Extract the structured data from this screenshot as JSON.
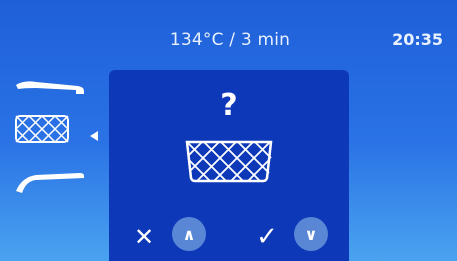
{
  "header": {
    "program": "134°C / 3 min",
    "time": "20:35"
  },
  "sidebar": {
    "items": [
      {
        "icon": "straight-handpiece-icon",
        "selected": false
      },
      {
        "icon": "basket-icon",
        "selected": true
      },
      {
        "icon": "contra-angle-handpiece-icon",
        "selected": false
      }
    ]
  },
  "dialog": {
    "prompt": "?",
    "icon": "basket-icon",
    "buttons": {
      "cancel": "✕",
      "up": "∧",
      "confirm": "✓",
      "down": "∨"
    }
  },
  "colors": {
    "background_top": "#1f5fd8",
    "background_bottom": "#4aa3ef",
    "dialog": "#0d39b8",
    "button": "#5a86d6"
  }
}
